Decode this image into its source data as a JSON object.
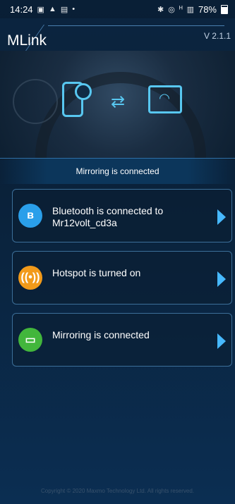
{
  "status_bar": {
    "time": "14:24",
    "left_icons": [
      "calendar-icon",
      "alert-icon",
      "image-icon",
      "dot-icon"
    ],
    "right_icons": [
      "bluetooth-icon",
      "nfc-icon",
      "signal-icon",
      "wifi-icon"
    ],
    "battery": "78%"
  },
  "header": {
    "title": "MLink",
    "version": "V 2.1.1"
  },
  "hero": {
    "icons": [
      "phone-icon",
      "transfer-arrows-icon",
      "screen-wifi-icon"
    ]
  },
  "banner": {
    "text": "Mirroring is connected"
  },
  "cards": [
    {
      "label": "Bluetooth is connected to Mr12volt_cd3a",
      "icon": "bluetooth-icon",
      "color": "#2a9fea"
    },
    {
      "label": "Hotspot is turned on",
      "icon": "hotspot-icon",
      "color": "#f29a1a"
    },
    {
      "label": "Mirroring is connected",
      "icon": "mirroring-icon",
      "color": "#42b63c"
    }
  ],
  "footer": {
    "text": "Copyright © 2020 Maxmo Technology Ltd. All rights reserved."
  }
}
